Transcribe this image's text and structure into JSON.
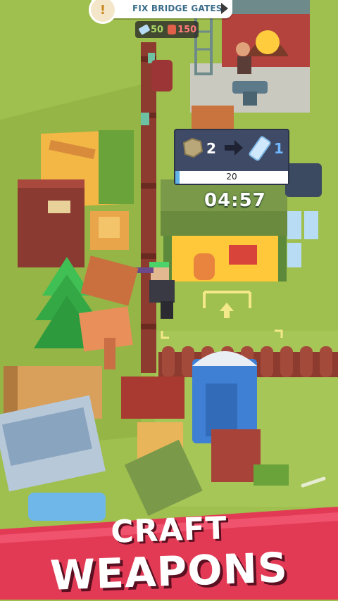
{
  "quest": {
    "icon": "alert-icon",
    "glyph": "!",
    "prefix": "FIX",
    "label": "BRIDGE GATES"
  },
  "resources": {
    "items": [
      {
        "icon": "crystal-icon",
        "value": "50",
        "color": "#a8d466"
      },
      {
        "icon": "wood-log-icon",
        "value": "150",
        "color": "#ff7a7a"
      }
    ]
  },
  "craft_panel": {
    "input_icon": "ore-chunk-icon",
    "input_amount": "2",
    "output_icon": "crystal-bar-icon",
    "output_amount": "1",
    "progress_count": "20",
    "progress_fraction": 0.04
  },
  "timer": "04:57",
  "banner": {
    "line1": "CRAFT",
    "line2": "WEAPONS",
    "color": "#e23a55"
  },
  "colors": {
    "grass": "#9fbf4e",
    "path": "#b8cf6c",
    "fence": "#8c3b2e",
    "roof": "#7a9a4a",
    "accent_blue": "#5fb3e6"
  }
}
